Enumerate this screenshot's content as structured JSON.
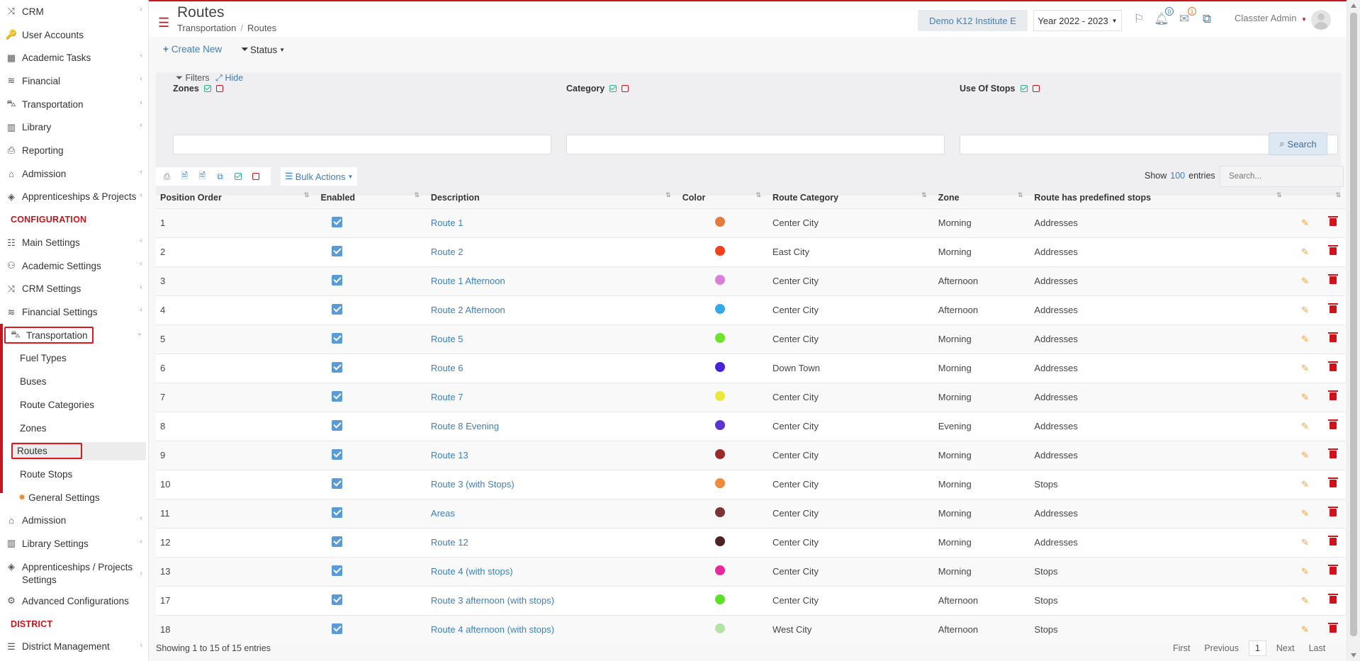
{
  "sidebar": {
    "top_items": [
      {
        "label": "CRM",
        "icon": "crm-icon",
        "glyph": "⤨",
        "chevron": true
      },
      {
        "label": "User Accounts",
        "icon": "key-icon",
        "glyph": "🔑",
        "chevron": false
      },
      {
        "label": "Academic Tasks",
        "icon": "grid-icon",
        "glyph": "▦",
        "chevron": true
      },
      {
        "label": "Financial",
        "icon": "coins-icon",
        "glyph": "≋",
        "chevron": true
      },
      {
        "label": "Transportation",
        "icon": "bus-icon",
        "glyph": "⛍",
        "chevron": true
      },
      {
        "label": "Library",
        "icon": "books-icon",
        "glyph": "▥",
        "chevron": true
      },
      {
        "label": "Reporting",
        "icon": "print-icon",
        "glyph": "⎙",
        "chevron": false
      },
      {
        "label": "Admission",
        "icon": "bank-icon",
        "glyph": "⌂",
        "chevron": true
      },
      {
        "label": "Apprenticeships & Projects",
        "icon": "cube-icon",
        "glyph": "◈",
        "chevron": true
      }
    ],
    "config_heading": "CONFIGURATION",
    "config_items": [
      {
        "label": "Main Settings",
        "icon": "sliders-icon",
        "glyph": "☷",
        "chevron": true
      },
      {
        "label": "Academic Settings",
        "icon": "people-icon",
        "glyph": "⚇",
        "chevron": true
      },
      {
        "label": "CRM Settings",
        "icon": "crm-icon",
        "glyph": "⤨",
        "chevron": true
      },
      {
        "label": "Financial Settings",
        "icon": "coins-icon",
        "glyph": "≋",
        "chevron": true
      }
    ],
    "transport": {
      "label": "Transportation",
      "icon": "bus-icon",
      "glyph": "⛍"
    },
    "transport_sub": [
      {
        "label": "Fuel Types"
      },
      {
        "label": "Buses"
      },
      {
        "label": "Route Categories"
      },
      {
        "label": "Zones"
      }
    ],
    "routes_label": "Routes",
    "route_stops_label": "Route Stops",
    "general_settings_label": "General Settings",
    "bottom_items": [
      {
        "label": "Admission",
        "icon": "bank-icon",
        "glyph": "⌂",
        "chevron": true
      },
      {
        "label": "Library Settings",
        "icon": "books-icon",
        "glyph": "▥",
        "chevron": true
      }
    ],
    "apprentice_settings": "Apprenticeships / Projects Settings",
    "advanced": "Advanced Configurations",
    "district_heading": "DISTRICT",
    "district_item": "District Management"
  },
  "header": {
    "title": "Routes",
    "breadcrumb": [
      "Transportation",
      "Routes"
    ],
    "institute": "Demo K12 Institute E",
    "year": "Year 2022 - 2023",
    "notifications_count": "0",
    "messages_count": "1",
    "user": "Classter Admin"
  },
  "toolbar": {
    "create_new": "Create New",
    "status": "Status"
  },
  "filters": {
    "label": "Filters",
    "hide": "Hide",
    "zones": "Zones",
    "category": "Category",
    "use_of_stops": "Use Of Stops",
    "search": "Search"
  },
  "table_tools": {
    "bulk_actions": "Bulk Actions",
    "show": "Show",
    "entries_count": "100",
    "entries": "entries",
    "search_placeholder": "Search..."
  },
  "table": {
    "columns": [
      "Position Order",
      "Enabled",
      "Description",
      "Color",
      "Route Category",
      "Zone",
      "Route has predefined stops"
    ],
    "rows": [
      {
        "order": "1",
        "description": "Route 1",
        "color": "#e07b39",
        "category": "Center City",
        "zone": "Morning",
        "stops": "Addresses"
      },
      {
        "order": "2",
        "description": "Route 2",
        "color": "#f0401c",
        "category": "East City",
        "zone": "Morning",
        "stops": "Addresses"
      },
      {
        "order": "3",
        "description": "Route 1 Afternoon",
        "color": "#d97fd8",
        "category": "Center City",
        "zone": "Afternoon",
        "stops": "Addresses"
      },
      {
        "order": "4",
        "description": "Route 2 Afternoon",
        "color": "#35a9e6",
        "category": "Center City",
        "zone": "Afternoon",
        "stops": "Addresses"
      },
      {
        "order": "5",
        "description": "Route 5",
        "color": "#6fe32a",
        "category": "Center City",
        "zone": "Morning",
        "stops": "Addresses"
      },
      {
        "order": "6",
        "description": "Route 6",
        "color": "#4a22d8",
        "category": "Down Town",
        "zone": "Morning",
        "stops": "Addresses"
      },
      {
        "order": "7",
        "description": "Route 7",
        "color": "#ece83a",
        "category": "Center City",
        "zone": "Morning",
        "stops": "Addresses"
      },
      {
        "order": "8",
        "description": "Route 8 Evening",
        "color": "#5a35cf",
        "category": "Center City",
        "zone": "Evening",
        "stops": "Addresses"
      },
      {
        "order": "9",
        "description": "Route 13",
        "color": "#962c2c",
        "category": "Center City",
        "zone": "Morning",
        "stops": "Addresses"
      },
      {
        "order": "10",
        "description": "Route 3 (with Stops)",
        "color": "#ee8a3a",
        "category": "Center City",
        "zone": "Morning",
        "stops": "Stops"
      },
      {
        "order": "11",
        "description": "Areas",
        "color": "#7a3434",
        "category": "Center City",
        "zone": "Morning",
        "stops": "Addresses"
      },
      {
        "order": "12",
        "description": "Route 12",
        "color": "#4c2424",
        "category": "Center City",
        "zone": "Morning",
        "stops": "Addresses"
      },
      {
        "order": "13",
        "description": "Route 4 (with stops)",
        "color": "#e8289c",
        "category": "Center City",
        "zone": "Morning",
        "stops": "Stops"
      },
      {
        "order": "17",
        "description": "Route 3 afternoon (with stops)",
        "color": "#5ce028",
        "category": "Center City",
        "zone": "Afternoon",
        "stops": "Stops"
      },
      {
        "order": "18",
        "description": "Route 4 afternoon (with stops)",
        "color": "#b4e4a4",
        "category": "West City",
        "zone": "Afternoon",
        "stops": "Stops"
      }
    ],
    "info": "Showing 1 to 15 of 15 entries"
  },
  "pager": {
    "first": "First",
    "previous": "Previous",
    "current": "1",
    "next": "Next",
    "last": "Last"
  }
}
